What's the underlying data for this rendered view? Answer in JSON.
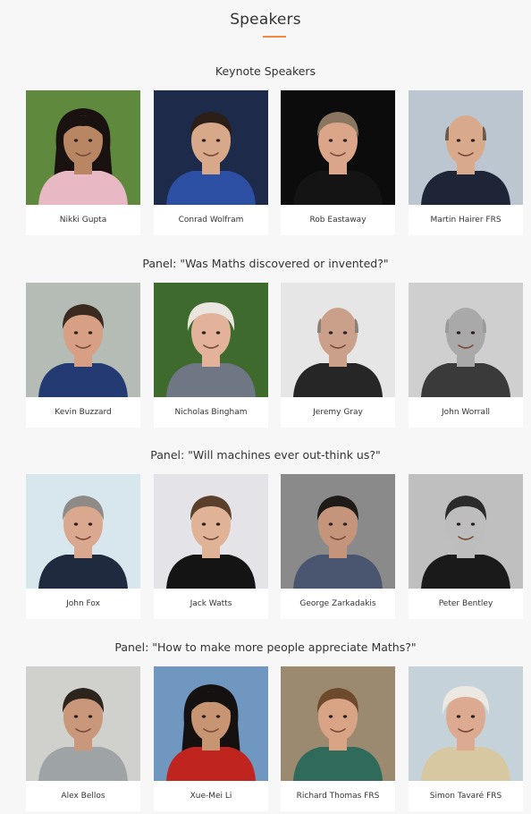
{
  "page": {
    "title": "Speakers",
    "accent_color": "#f0883e"
  },
  "sections": [
    {
      "heading": "Keynote Speakers",
      "speakers": [
        {
          "name": "Nikki Gupta",
          "bg": "#5f8a3e",
          "hair": "#1a1210",
          "skin": "#b98664",
          "shirt": "#e8b9c4",
          "hair_style": "long"
        },
        {
          "name": "Conrad Wolfram",
          "bg": "#1d2a4a",
          "hair": "#2a1e16",
          "skin": "#d7a98a",
          "shirt": "#2d4fa3",
          "hair_style": "short"
        },
        {
          "name": "Rob Eastaway",
          "bg": "#0c0c0c",
          "hair": "#8a7660",
          "skin": "#dba58a",
          "shirt": "#141414",
          "hair_style": "short"
        },
        {
          "name": "Martin Hairer FRS",
          "bg": "#bcc6d0",
          "hair": "#6d5a48",
          "skin": "#d9a98b",
          "shirt": "#1e2536",
          "hair_style": "bald"
        }
      ]
    },
    {
      "heading": "Panel: \"Was Maths discovered or invented?\"",
      "speakers": [
        {
          "name": "Kevin Buzzard",
          "bg": "#b5bcb6",
          "hair": "#3a2a20",
          "skin": "#d7a084",
          "shirt": "#243a72",
          "hair_style": "short"
        },
        {
          "name": "Nicholas Bingham",
          "bg": "#3f6a2e",
          "hair": "#e9e6df",
          "skin": "#e2b39a",
          "shirt": "#6f7684",
          "hair_style": "white"
        },
        {
          "name": "Jeremy Gray",
          "bg": "#e6e6e6",
          "hair": "#8c8074",
          "skin": "#caa08a",
          "shirt": "#262626",
          "hair_style": "bald"
        },
        {
          "name": "John Worrall",
          "bg": "#cfcfcf",
          "hair": "#9a9a9a",
          "skin": "#a9a9a9",
          "shirt": "#3a3a3a",
          "hair_style": "bald"
        }
      ]
    },
    {
      "heading": "Panel: \"Will machines ever out-think us?\"",
      "speakers": [
        {
          "name": "John Fox",
          "bg": "#d8e6ee",
          "hair": "#8e8a86",
          "skin": "#d9a88e",
          "shirt": "#1f2a3e",
          "hair_style": "short"
        },
        {
          "name": "Jack Watts",
          "bg": "#e3e3e8",
          "hair": "#5a3f2a",
          "skin": "#e0b296",
          "shirt": "#141414",
          "hair_style": "short"
        },
        {
          "name": "George Zarkadakis",
          "bg": "#8a8a8a",
          "hair": "#1e1a17",
          "skin": "#c4957a",
          "shirt": "#4a5570",
          "hair_style": "short"
        },
        {
          "name": "Peter Bentley",
          "bg": "#bfbfbf",
          "hair": "#2b2b2b",
          "skin": "#bdbdbd",
          "shirt": "#1a1a1a",
          "hair_style": "short"
        }
      ]
    },
    {
      "heading": "Panel: \"How to make more people appreciate Maths?\"",
      "speakers": [
        {
          "name": "Alex Bellos",
          "bg": "#d0d0cc",
          "hair": "#2d241e",
          "skin": "#c9977a",
          "shirt": "#9ea3a6",
          "hair_style": "short"
        },
        {
          "name": "Xue-Mei Li",
          "bg": "#6f97c0",
          "hair": "#151111",
          "skin": "#c89572",
          "shirt": "#c0241f",
          "hair_style": "long"
        },
        {
          "name": "Richard Thomas FRS",
          "bg": "#9b8a70",
          "hair": "#6d4a2c",
          "skin": "#d9a486",
          "shirt": "#2f6a5a",
          "hair_style": "short"
        },
        {
          "name": "Simon Tavaré FRS",
          "bg": "#c6d2da",
          "hair": "#ece8e2",
          "skin": "#dcaa90",
          "shirt": "#d8c8a2",
          "hair_style": "white"
        }
      ]
    }
  ]
}
